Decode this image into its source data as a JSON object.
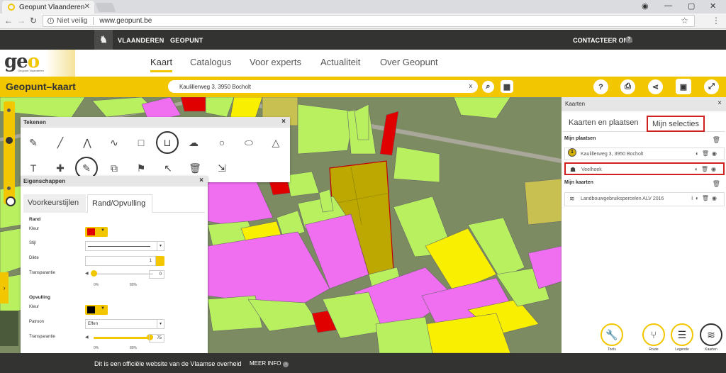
{
  "browser": {
    "tab_title": "Geopunt Vlaanderen",
    "security": "Niet veilig",
    "url": "www.geopunt.be"
  },
  "topbar": {
    "items": [
      "VLAANDEREN",
      "GEOPUNT"
    ],
    "contact": "CONTACTEER ONS"
  },
  "nav": {
    "logo": "geo",
    "logo_sub": "Geopunt Vlaanderen",
    "links": [
      "Kaart",
      "Catalogus",
      "Voor experts",
      "Actualiteit",
      "Over Geopunt"
    ],
    "active": "Kaart"
  },
  "toolbar": {
    "title": "Geopunt–kaart",
    "search_value": "Kaulillerweg 3, 3950 Bocholt",
    "search_clear": "x"
  },
  "tekenen": {
    "title": "Tekenen",
    "close": "×"
  },
  "eigenschappen": {
    "title": "Eigenschappen",
    "close": "×",
    "tabs": [
      "Voorkeurstijlen",
      "Rand/Opvulling"
    ],
    "active_tab": "Rand/Opvulling",
    "rand": {
      "heading": "Rand",
      "kleur_label": "Kleur",
      "kleur_color": "#e00000",
      "stijl_label": "Stijl",
      "dikte_label": "Dikte",
      "dikte_value": "1",
      "transparantie_label": "Transparantie",
      "transparantie_value": "0",
      "transparantie_fraction": 0.0,
      "tick_min": "0%",
      "tick_max": "80%"
    },
    "opvulling": {
      "heading": "Opvulling",
      "kleur_label": "Kleur",
      "kleur_color": "#000000",
      "patroon_label": "Patroon",
      "patroon_value": "Effen",
      "transparantie_label": "Transparantie",
      "transparantie_value": "75",
      "transparantie_fraction": 0.94,
      "tick_min": "0%",
      "tick_max": "80%"
    }
  },
  "right_panel": {
    "title": "Kaarten",
    "close": "×",
    "tabs": [
      "Kaarten en plaatsen",
      "Mijn selecties"
    ],
    "active_tab": "Mijn selecties",
    "places_heading": "Mijn plaatsen",
    "places": [
      "Kaulillerweg 3, 3950 Bocholt",
      "Veelhoek"
    ],
    "pin_number": "1",
    "maps_heading": "Mijn kaarten",
    "maps": [
      "Landbouwgebruikspercelen ALV 2016"
    ],
    "buttons": [
      "Tools",
      "Route",
      "Legende",
      "Kaarten"
    ]
  },
  "footer": {
    "text": "Dit is een officiële website van de Vlaamse overheid",
    "more": "MEER INFO"
  },
  "colors": {
    "accent": "#f2c600",
    "dark": "#333332",
    "highlight": "#d12020",
    "parcel_green": "#b8f060",
    "parcel_pink": "#f06ef0",
    "parcel_yellow": "#f8f000",
    "parcel_red": "#e00000",
    "parcel_selected": "#bca800"
  }
}
